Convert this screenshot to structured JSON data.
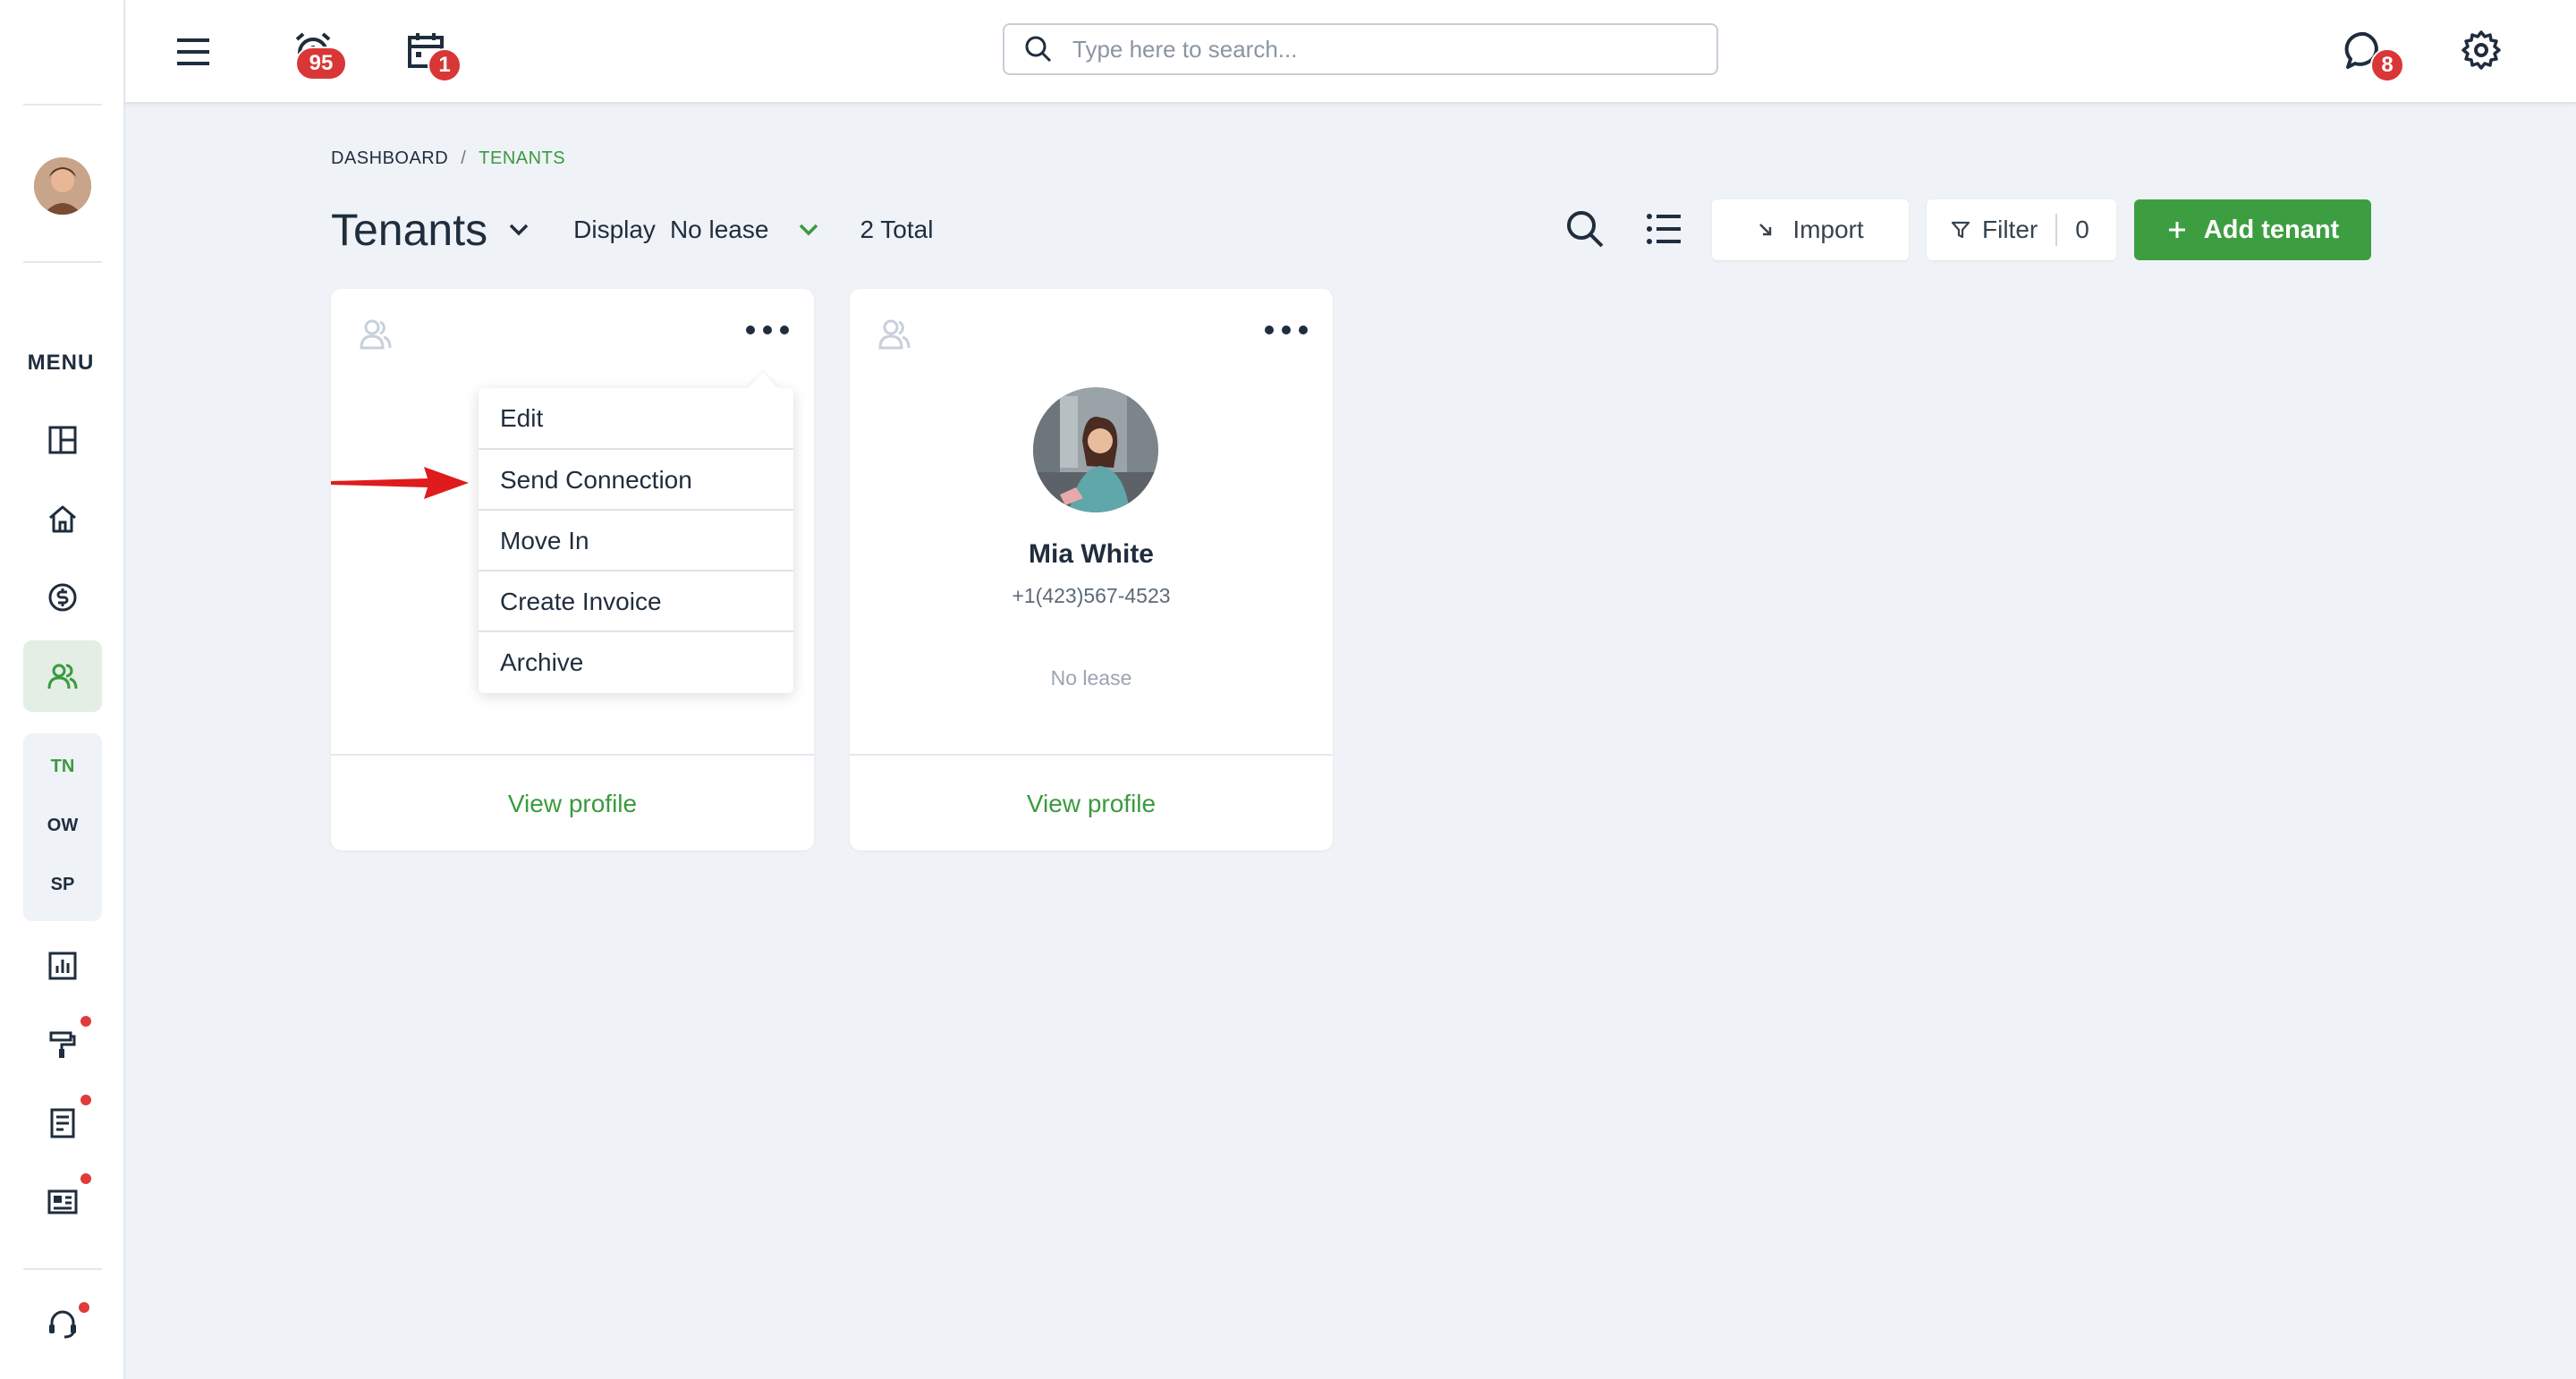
{
  "topbar": {
    "alarm_badge": "95",
    "calendar_badge": "1",
    "chat_badge": "8",
    "search_placeholder": "Type here to search..."
  },
  "sidebar": {
    "menu_label": "MENU",
    "group_items": [
      "TN",
      "OW",
      "SP"
    ]
  },
  "breadcrumb": {
    "root": "DASHBOARD",
    "separator": "/",
    "current": "TENANTS"
  },
  "header": {
    "title": "Tenants",
    "display_label": "Display",
    "display_value": "No lease",
    "total": "2 Total",
    "import_label": "Import",
    "filter_label": "Filter",
    "filter_count": "0",
    "add_label": "Add tenant"
  },
  "cards": [
    {
      "name": "",
      "phone": "",
      "lease": "",
      "view_label": "View profile"
    },
    {
      "name": "Mia White",
      "phone": "+1(423)567-4523",
      "lease": "No lease",
      "view_label": "View profile"
    }
  ],
  "dropdown": {
    "items": [
      "Edit",
      "Send Connection",
      "Move In",
      "Create Invoice",
      "Archive"
    ]
  },
  "colors": {
    "accent": "#3d9e41",
    "badge": "#d93636",
    "arrow": "#e01b1b"
  }
}
